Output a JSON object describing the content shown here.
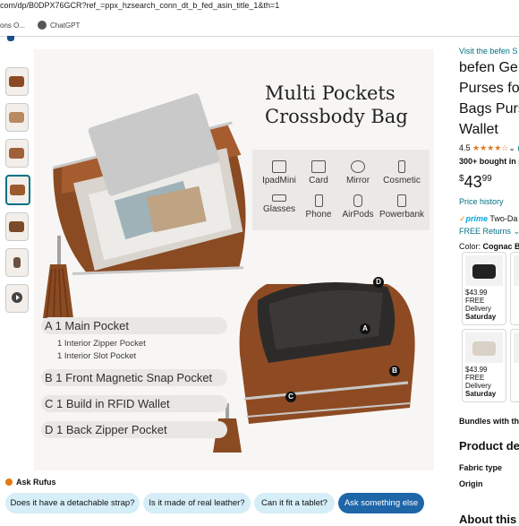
{
  "browser": {
    "url": "com/dp/B0DPX76GCR?ref_=ppx_hzsearch_conn_dt_b_fed_asin_title_1&th=1",
    "bookmarks": [
      "ons O...",
      "ChatGPT"
    ]
  },
  "gallery": {
    "headline_line1": "Multi Pockets",
    "headline_line2": "Crossbody Bag",
    "features": [
      "IpadMini",
      "Card",
      "Mirror",
      "Cosmetic",
      "Glasses",
      "Phone",
      "AirPods",
      "Powerbank"
    ],
    "pockets": {
      "a": "A 1 Main Pocket",
      "a_sub1": "1 Interior Zipper Pocket",
      "a_sub2": "1 Interior Slot Pocket",
      "b": "B 1 Front Magnetic Snap Pocket",
      "c": "C 1 Build in RFID Wallet",
      "d": "D 1 Back Zipper Pocket"
    },
    "markers": [
      "D",
      "A",
      "B",
      "C"
    ]
  },
  "product": {
    "visit": "Visit the befen S",
    "title_lines": [
      "befen Gen",
      "Purses fo",
      "Bags Purs",
      "Wallet"
    ],
    "rating": "4.5",
    "stars": "★★★★☆",
    "rating_suffix": "(",
    "bought": "300+ bought in pa",
    "price_symbol": "$",
    "price_whole": "43",
    "price_fraction": "99",
    "price_history": "Price history",
    "prime_label": "prime",
    "prime_text": "Two-Da",
    "free_returns": "FREE Returns",
    "color_label": "Color:",
    "color_value": "Cognac B",
    "swatches": [
      {
        "price": "$43.99",
        "line1": "FREE Delivery",
        "line2": "Saturday",
        "color": "#222222"
      },
      {
        "price": "$43.99",
        "line1": "FREE Delivery",
        "line2": "Saturday",
        "color": "#d9d1c8"
      }
    ],
    "bundles": "Bundles with th",
    "product_details": "Product de",
    "fabric_type": "Fabric type",
    "origin": "Origin",
    "about": "About this"
  },
  "rufus": {
    "title": "Ask Rufus",
    "chips": [
      "Does it have a detachable strap?",
      "Is it made of real leather?",
      "Can it fit a tablet?",
      "Ask something else"
    ]
  }
}
